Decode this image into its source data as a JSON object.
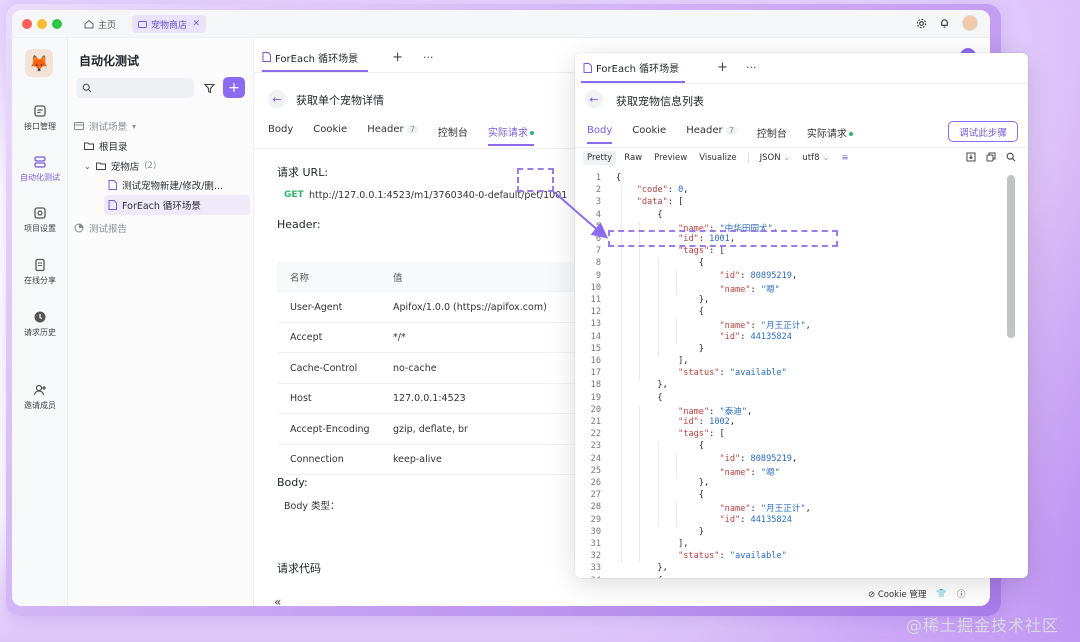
{
  "window": {
    "tabs": [
      {
        "label": "主页",
        "icon": "home-icon"
      },
      {
        "label": "宠物商店",
        "icon": "folder-icon"
      }
    ]
  },
  "rail": {
    "items": [
      {
        "label": "接口管理",
        "icon": "api-icon"
      },
      {
        "label": "自动化测试",
        "icon": "layers-icon",
        "active": true
      },
      {
        "label": "项目设置",
        "icon": "settings-icon"
      },
      {
        "label": "在线分享",
        "icon": "share-icon"
      },
      {
        "label": "请求历史",
        "icon": "history-icon"
      },
      {
        "label": "邀请成员",
        "icon": "add-user-icon"
      }
    ]
  },
  "panel": {
    "title": "自动化测试",
    "add_label": "+",
    "tree": [
      {
        "label": "测试场景",
        "suffix": "▾"
      },
      {
        "label": "根目录"
      },
      {
        "label": "宠物店",
        "count": "(2)"
      },
      {
        "label": "测试宠物新建/修改/删..."
      },
      {
        "label": "ForEach 循环场景"
      },
      {
        "label": "测试报告"
      }
    ]
  },
  "main": {
    "doc_tab": "ForEach 循环场景",
    "title": "获取单个宠物详情",
    "subtabs": [
      "Body",
      "Cookie",
      "Header",
      "控制台",
      "实际请求"
    ],
    "header_badge": "7",
    "url_section": "请求 URL:",
    "method": "GET",
    "url": "http://127.0.0.1:4523/m1/3760340-0-default/pet/1001",
    "header_section": "Header:",
    "table_head": {
      "name": "名称",
      "value": "值"
    },
    "headers": [
      {
        "name": "User-Agent",
        "value": "Apifox/1.0.0 (https://apifox.com)"
      },
      {
        "name": "Accept",
        "value": "*/*"
      },
      {
        "name": "Cache-Control",
        "value": "no-cache"
      },
      {
        "name": "Host",
        "value": "127.0.0.1:4523"
      },
      {
        "name": "Accept-Encoding",
        "value": "gzip, deflate, br"
      },
      {
        "name": "Connection",
        "value": "keep-alive"
      }
    ],
    "body_section": "Body:",
    "body_type": "Body 类型：",
    "code_section": "请求代码",
    "collapse": "«"
  },
  "response": {
    "doc_tab": "ForEach 循环场景",
    "title": "获取宠物信息列表",
    "subtabs": [
      "Body",
      "Cookie",
      "Header",
      "控制台",
      "实际请求"
    ],
    "header_badge": "7",
    "run_button": "调试此步骤",
    "formats": [
      "Pretty",
      "Raw",
      "Preview",
      "Visualize"
    ],
    "type_select": "JSON",
    "encoding_select": "utf8",
    "lines": [
      "{",
      "    \"code\": 0,",
      "    \"data\": [",
      "        {",
      "            \"name\": \"中华田园犬\",",
      "            \"id\": 1001,",
      "            \"tags\": [",
      "                {",
      "                    \"id\": 80895219,",
      "                    \"name\": \"嗯\"",
      "                },",
      "                {",
      "                    \"name\": \"月王正计\",",
      "                    \"id\": 44135824",
      "                }",
      "            ],",
      "            \"status\": \"available\"",
      "        },",
      "        {",
      "            \"name\": \"泰迪\",",
      "            \"id\": 1002,",
      "            \"tags\": [",
      "                {",
      "                    \"id\": 80895219,",
      "                    \"name\": \"嗯\"",
      "                },",
      "                {",
      "                    \"name\": \"月王正计\",",
      "                    \"id\": 44135824",
      "                }",
      "            ],",
      "            \"status\": \"available\"",
      "        },",
      "        {"
    ]
  },
  "statusbar": {
    "cookie": "Cookie 管理"
  },
  "watermark": "@稀土掘金技术社区",
  "colors": {
    "accent": "#8b6cf0",
    "get": "#2fb36b",
    "json_key": "#b5433f",
    "json_value": "#2a6cbf"
  }
}
